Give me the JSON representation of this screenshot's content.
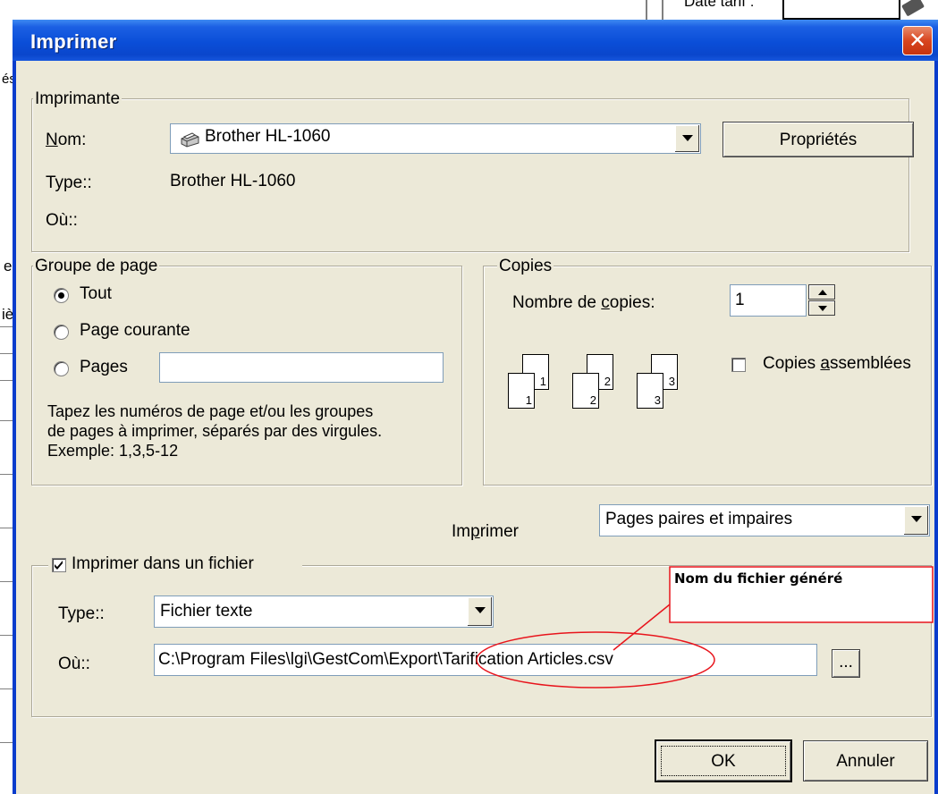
{
  "dialog": {
    "title": "Imprimer",
    "close_label": "✕"
  },
  "printer": {
    "group_label": "Imprimante",
    "name_label": "Nom:",
    "name_value": "Brother HL-1060",
    "properties_button": "Propriétés",
    "type_label": "Type::",
    "type_value": "Brother HL-1060",
    "where_label": "Où::"
  },
  "page_group": {
    "group_label": "Groupe de page",
    "options": [
      {
        "label": "Tout",
        "selected": true
      },
      {
        "label": "Page courante",
        "selected": false
      },
      {
        "label": "Pages",
        "selected": false
      }
    ],
    "pages_value": "",
    "help_lines": [
      "Tapez les numéros de page et/ou les groupes",
      "de pages à imprimer, séparés par des virgules.",
      "Exemple: 1,3,5-12"
    ]
  },
  "copies": {
    "group_label": "Copies",
    "count_label": "Nombre de copies:",
    "count_value": "1",
    "collate_label": "Copies assemblées",
    "collate_checked": false,
    "collate_icons": [
      {
        "front": "1",
        "back": "1"
      },
      {
        "front": "2",
        "back": "2"
      },
      {
        "front": "3",
        "back": "3"
      }
    ]
  },
  "print_range": {
    "label": "Imprimer",
    "value": "Pages paires et impaires"
  },
  "print_to_file": {
    "label": "Imprimer dans un fichier",
    "checked": true,
    "type_label": "Type::",
    "type_value": "Fichier texte",
    "where_label": "Où::",
    "where_value": "C:\\Program Files\\lgi\\GestCom\\Export\\Tarification Articles.csv",
    "browse_button": "..."
  },
  "annotation": {
    "text": "Nom du fichier généré",
    "color": "#ff0000"
  },
  "buttons": {
    "ok": "OK",
    "cancel": "Annuler"
  },
  "background_app": {
    "field_label": "Date tarif :",
    "side_chars": [
      "és",
      "e",
      "iè"
    ]
  }
}
